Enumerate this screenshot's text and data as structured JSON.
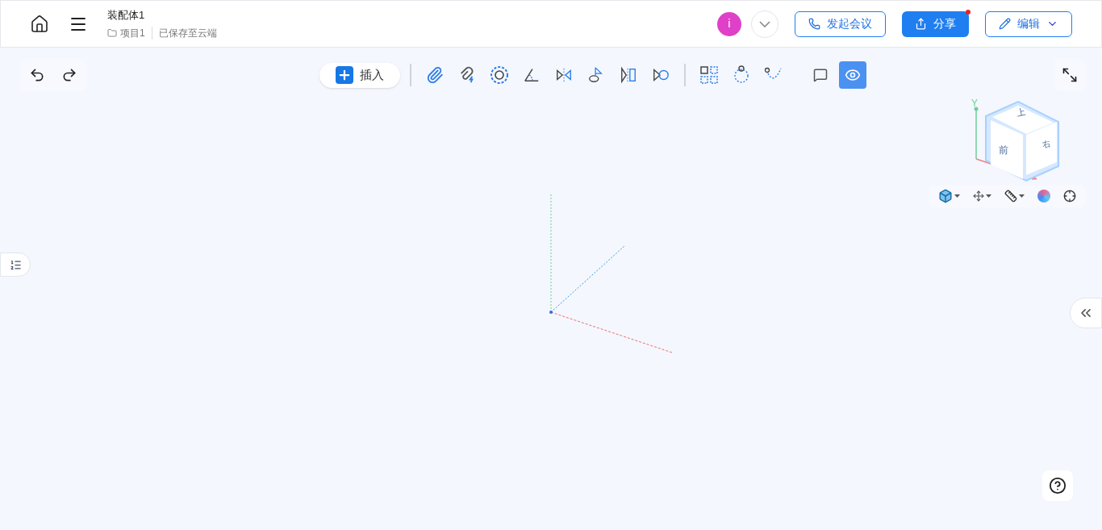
{
  "header": {
    "title": "装配体1",
    "project": "项目1",
    "save_status": "已保存至云端",
    "avatar": "i",
    "buttons": [
      {
        "kind": "meeting",
        "label": "发起会议",
        "notification": false
      },
      {
        "kind": "share",
        "label": "分享",
        "notification": true
      },
      {
        "kind": "edit",
        "label": "编辑",
        "notification": false
      }
    ]
  },
  "toolbar": {
    "insert_label": "插入",
    "groups": [
      {
        "divider": true,
        "tools": [
          {
            "kind": "paperclip",
            "selected": false
          },
          {
            "kind": "paperclip-bolt",
            "selected": false
          },
          {
            "kind": "circle-dashed",
            "selected": false
          },
          {
            "kind": "angle",
            "selected": false
          },
          {
            "kind": "mirror",
            "selected": false
          },
          {
            "kind": "flag-ellipse",
            "selected": false
          },
          {
            "kind": "flag-rect",
            "selected": false
          },
          {
            "kind": "flag-circle",
            "selected": false
          }
        ]
      },
      {
        "divider": true,
        "tools": [
          {
            "kind": "grid-pattern",
            "selected": false
          },
          {
            "kind": "circle-pattern",
            "selected": false
          },
          {
            "kind": "curve-pattern",
            "selected": false
          }
        ]
      },
      {
        "divider": false,
        "tools": [
          {
            "kind": "comment",
            "selected": false
          },
          {
            "kind": "eye",
            "selected": true
          }
        ]
      }
    ]
  },
  "view_cube": {
    "axis_y": "Y",
    "top": "上",
    "front": "前",
    "right": "右"
  },
  "view_tools": [
    {
      "kind": "cube",
      "dropdown": true
    },
    {
      "kind": "move",
      "dropdown": true
    },
    {
      "kind": "ruler",
      "dropdown": true
    },
    {
      "kind": "color",
      "dropdown": false
    },
    {
      "kind": "target",
      "dropdown": false
    }
  ]
}
